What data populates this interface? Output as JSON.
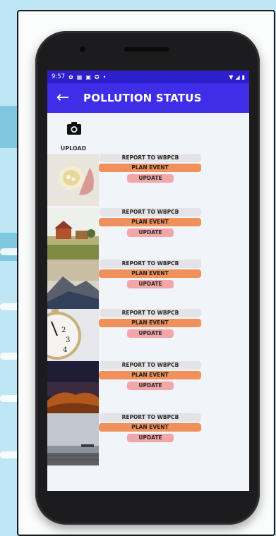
{
  "status_bar": {
    "time": "9:57",
    "icons": [
      "gear-icon",
      "calendar-icon",
      "image-icon",
      "android-icon",
      "dot-icon"
    ],
    "right_icons": [
      "wifi-icon",
      "signal-icon",
      "battery-icon"
    ]
  },
  "app_bar": {
    "title": "POLLUTION STATUS",
    "back_icon": "arrow-back-icon"
  },
  "upload": {
    "label": "UPLOAD",
    "icon": "camera-icon"
  },
  "items": [
    {
      "report_label": "REPORT TO WBPCB",
      "plan_label": "PLAN EVENT",
      "update_label": "UPDATE",
      "image": "hand-holding-cup"
    },
    {
      "report_label": "REPORT TO WBPCB",
      "plan_label": "PLAN EVENT",
      "update_label": "UPDATE",
      "image": "rural-house-field"
    },
    {
      "report_label": "REPORT TO WBPCB",
      "plan_label": "PLAN EVENT",
      "update_label": "UPDATE",
      "image": "mountain-landscape"
    },
    {
      "report_label": "REPORT TO WBPCB",
      "plan_label": "PLAN EVENT",
      "update_label": "UPDATE",
      "image": "alarm-clock"
    },
    {
      "report_label": "REPORT TO WBPCB",
      "plan_label": "PLAN EVENT",
      "update_label": "UPDATE",
      "image": "desert-dunes-night"
    },
    {
      "report_label": "REPORT TO WBPCB",
      "plan_label": "PLAN EVENT",
      "update_label": "UPDATE",
      "image": "misty-pier"
    }
  ],
  "colors": {
    "status_bar": "#2d1fc9",
    "app_bar": "#3f2ee8",
    "report": "#e4e4e8",
    "plan": "#f0905a",
    "update": "#f3a6a8",
    "screen_bg": "#f1f4f9"
  }
}
